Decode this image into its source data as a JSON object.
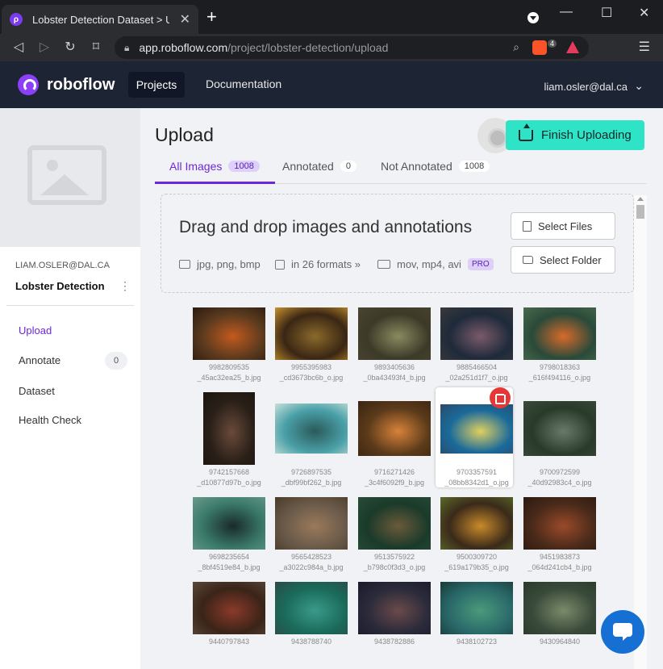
{
  "browser": {
    "tab_title": "Lobster Detection Dataset > Uplo",
    "tab_close": "✕",
    "new_tab": "+",
    "address_host": "app.roboflow.com",
    "address_path": "/project/lobster-detection/upload",
    "brave_badge": "4",
    "window_minimize": "—",
    "window_maximize": "☐",
    "window_close": "✕"
  },
  "header": {
    "logo": "roboflow",
    "nav_projects": "Projects",
    "nav_docs": "Documentation",
    "user": "liam.osler@dal.ca"
  },
  "sidebar": {
    "email": "LIAM.OSLER@DAL.CA",
    "project": "Lobster Detection",
    "items": [
      {
        "label": "Upload",
        "active": true
      },
      {
        "label": "Annotate",
        "count": "0"
      },
      {
        "label": "Dataset"
      },
      {
        "label": "Health Check"
      }
    ]
  },
  "main": {
    "title": "Upload",
    "finish_button": "Finish Uploading",
    "tabs": [
      {
        "label": "All Images",
        "count": "1008"
      },
      {
        "label": "Annotated",
        "count": "0"
      },
      {
        "label": "Not Annotated",
        "count": "1008"
      }
    ],
    "dropzone": {
      "title": "Drag and drop images and annotations",
      "formats_images": "jpg, png, bmp",
      "formats_annotations": "in 26 formats »",
      "formats_video": "mov, mp4, avi",
      "pro_badge": "PRO",
      "select_files": "Select Files",
      "select_folder": "Select Folder"
    }
  },
  "images": [
    {
      "line1": "9982809535",
      "line2": "_45ac32ea25_b.jpg",
      "colors": [
        "#5a3a1e",
        "#c25a1e",
        "#2a1a10"
      ]
    },
    {
      "line1": "9955395983",
      "line2": "_cd3673bc6b_o.jpg",
      "colors": [
        "#3a2614",
        "#8a6a2a",
        "#c9932e"
      ]
    },
    {
      "line1": "9893405636",
      "line2": "_0ba43493f4_b.jpg",
      "colors": [
        "#3c3a28",
        "#8a8a60",
        "#4a4430"
      ]
    },
    {
      "line1": "9885466504",
      "line2": "_02a251d1f7_o.jpg",
      "colors": [
        "#1e2a3a",
        "#7a5a6a",
        "#3a3a3a"
      ]
    },
    {
      "line1": "9798018363",
      "line2": "_616f494116_o.jpg",
      "colors": [
        "#2a4a3a",
        "#d86a2a",
        "#4a6a4a"
      ]
    },
    {
      "line1": "9742157668",
      "line2": "_d10877d97b_o.jpg",
      "colors": [
        "#2a2018",
        "#6a4a3a",
        "#1a1410"
      ]
    },
    {
      "line1": "9726897535",
      "line2": "_dbf99bf262_b.jpg",
      "colors": [
        "#4aa0a8",
        "#2a5a5a",
        "#c8e0d8"
      ]
    },
    {
      "line1": "9716271426",
      "line2": "_3c4f6092f9_b.jpg",
      "colors": [
        "#5a3a1a",
        "#d8823a",
        "#3a2412"
      ]
    },
    {
      "line1": "9703357591",
      "line2": "_08bb8342d1_o.jpg",
      "colors": [
        "#1a6a9a",
        "#e0d060",
        "#2a4a6a"
      ]
    },
    {
      "line1": "9700972599",
      "line2": "_40d92983c4_o.jpg",
      "colors": [
        "#2a3a2a",
        "#6a7a6a",
        "#3a4a3a"
      ]
    },
    {
      "line1": "9698235654",
      "line2": "_8bf4519e84_b.jpg",
      "colors": [
        "#3a7a6a",
        "#1a2a2a",
        "#6a9a8a"
      ]
    },
    {
      "line1": "9565428523",
      "line2": "_a3022c984a_b.jpg",
      "colors": [
        "#6a5a4a",
        "#9a7a5a",
        "#4a3a2a"
      ]
    },
    {
      "line1": "9513575922",
      "line2": "_b798c0f3d3_o.jpg",
      "colors": [
        "#1a3a2a",
        "#6a5a3a",
        "#2a4a3a"
      ]
    },
    {
      "line1": "9500309720",
      "line2": "_619a179b35_o.jpg",
      "colors": [
        "#3a2a1a",
        "#c88a2a",
        "#5a6a2a"
      ]
    },
    {
      "line1": "9451983873",
      "line2": "_064d241cb4_b.jpg",
      "colors": [
        "#4a2a1a",
        "#9a4a2a",
        "#2a1a10"
      ]
    },
    {
      "line1": "9440797843",
      "line2": "",
      "colors": [
        "#3a2418",
        "#8a3a2a",
        "#5a4a3a"
      ]
    },
    {
      "line1": "9438788740",
      "line2": "",
      "colors": [
        "#1a6a5a",
        "#3a9a8a",
        "#2a4a4a"
      ]
    },
    {
      "line1": "9438782886",
      "line2": "",
      "colors": [
        "#2a2a3a",
        "#6a4a4a",
        "#1a1a2a"
      ]
    },
    {
      "line1": "9438102723",
      "line2": "",
      "colors": [
        "#2a6a6a",
        "#4a9a7a",
        "#1a3a3a"
      ]
    },
    {
      "line1": "9430964840",
      "line2": "",
      "colors": [
        "#3a4a3a",
        "#7a8a6a",
        "#2a3a2a"
      ]
    }
  ],
  "colors": {
    "accent": "#6d28d9",
    "finish": "#2fe3c7",
    "delete": "#e63737",
    "chat": "#1670d4"
  }
}
